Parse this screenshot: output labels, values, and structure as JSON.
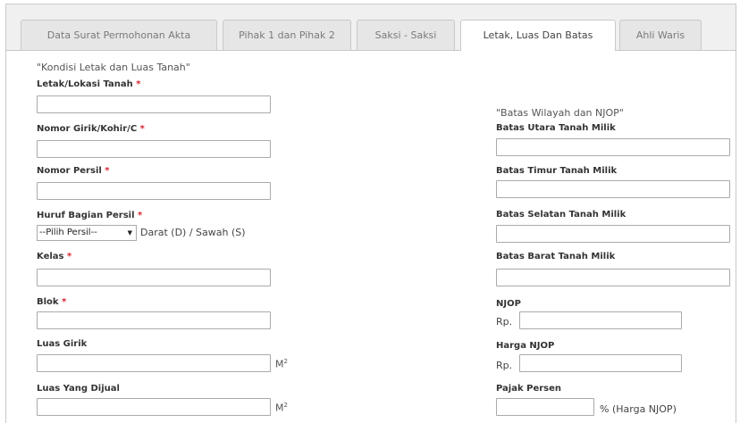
{
  "tabs": [
    {
      "label": "Data Surat Permohonan Akta",
      "active": false
    },
    {
      "label": "Pihak 1 dan Pihak 2",
      "active": false
    },
    {
      "label": "Saksi - Saksi",
      "active": false
    },
    {
      "label": "Letak, Luas Dan Batas",
      "active": true
    },
    {
      "label": "Ahli Waris",
      "active": false
    }
  ],
  "left": {
    "heading": "\"Kondisi Letak dan Luas Tanah\"",
    "required_mark": "*",
    "letak": "Letak/Lokasi Tanah",
    "girik": "Nomor Girik/Kohir/C",
    "persil": "Nomor Persil",
    "huruf": "Huruf Bagian Persil",
    "select_value": "--Pilih Persil--",
    "select_caret": "▼",
    "select_hint": "Darat (D) / Sawah (S)",
    "kelas": "Kelas",
    "blok": "Blok",
    "luas_girik": "Luas Girik",
    "luas_dijual": "Luas Yang Dijual",
    "unit_m": "M",
    "unit_exp": "2"
  },
  "right": {
    "heading": "\"Batas Wilayah dan NJOP\"",
    "utara": "Batas Utara Tanah Milik",
    "timur": "Batas Timur Tanah Milik",
    "selatan": "Batas Selatan Tanah Milik",
    "barat": "Batas Barat Tanah Milik",
    "njop": "NJOP",
    "rp": "Rp.",
    "harga_njop": "Harga NJOP",
    "pajak": "Pajak Persen",
    "pajak_suffix": "% (Harga NJOP)"
  }
}
